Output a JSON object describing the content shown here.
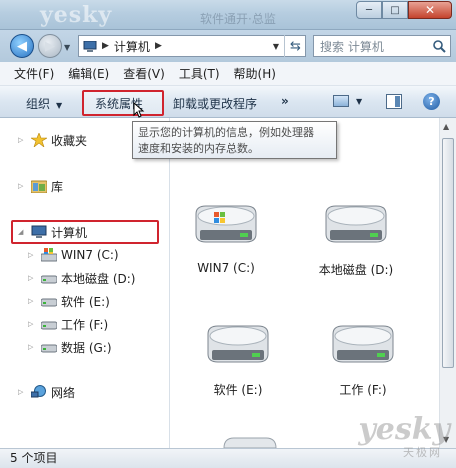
{
  "window": {
    "watermark_logo": "yesky",
    "watermark_text": "软件通开·总监",
    "minimize": "─",
    "maximize": "□",
    "close": "✕"
  },
  "address": {
    "path": "计算机",
    "search_placeholder": "搜索 计算机"
  },
  "menu": [
    "文件(F)",
    "编辑(E)",
    "查看(V)",
    "工具(T)",
    "帮助(H)"
  ],
  "toolbar": {
    "organize": "组织",
    "system_properties": "系统属性",
    "uninstall": "卸载或更改程序",
    "more": "»",
    "help": "?"
  },
  "tooltip": {
    "line1": "显示您的计算机的信息，例如处理器",
    "line2": "速度和安装的内存总数。"
  },
  "nav": {
    "favorites": "收藏夹",
    "libraries": "库",
    "computer": "计算机",
    "drives": [
      "WIN7 (C:)",
      "本地磁盘 (D:)",
      "软件 (E:)",
      "工作 (F:)",
      "数据 (G:)"
    ],
    "network": "网络"
  },
  "drives": [
    "WIN7 (C:)",
    "本地磁盘 (D:)",
    "软件 (E:)",
    "工作 (F:)"
  ],
  "status": {
    "count": "5 个项目"
  },
  "brand": {
    "logo": "yesky",
    "sub": "天极网"
  },
  "colors": {
    "highlight": "#d0242e",
    "accent": "#2a73c2"
  }
}
